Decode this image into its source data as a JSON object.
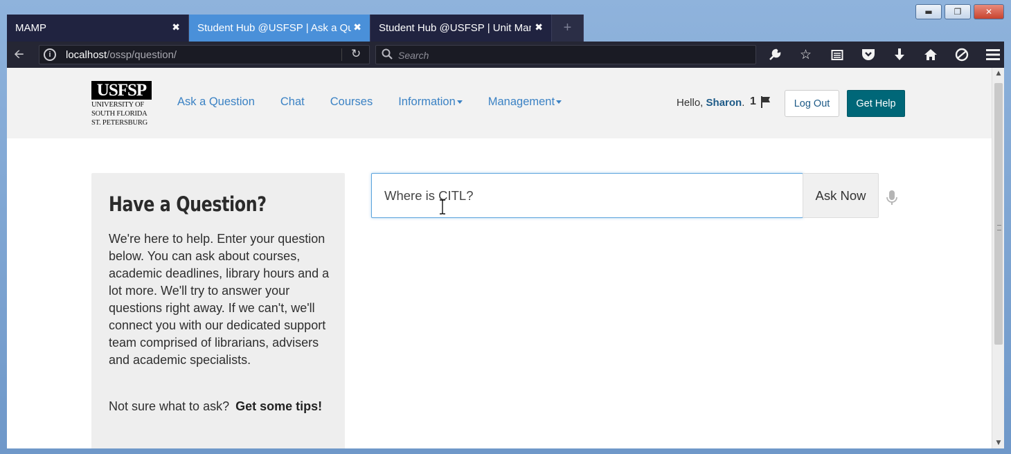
{
  "window": {
    "controls": [
      "minimize",
      "maximize",
      "close"
    ]
  },
  "tabs": [
    {
      "label": "MAMP",
      "active": false
    },
    {
      "label": "Student Hub @USFSP | Ask a Que",
      "active": true
    },
    {
      "label": "Student Hub @USFSP | Unit Mana",
      "active": false
    }
  ],
  "toolbar": {
    "url_host": "localhost",
    "url_path": "/ossp/question/",
    "search_placeholder": "Search",
    "icons": [
      "wrench-icon",
      "star-icon",
      "reading-list-icon",
      "pocket-icon",
      "download-icon",
      "home-icon",
      "sync-icon",
      "menu-icon"
    ]
  },
  "site": {
    "logo_mark": "USFSP",
    "logo_line1": "UNIVERSITY OF",
    "logo_line2": "SOUTH FLORIDA",
    "logo_line3": "ST. PETERSBURG",
    "nav": {
      "ask": "Ask a Question",
      "chat": "Chat",
      "courses": "Courses",
      "information": "Information",
      "management": "Management"
    },
    "greeting_prefix": "Hello, ",
    "user_name": "Sharon",
    "greeting_suffix": ".",
    "flag_count": "1",
    "logout_label": "Log Out",
    "help_label": "Get Help",
    "accent_color": "#006778",
    "link_color": "#3b82c4"
  },
  "main": {
    "card_title": "Have a Question?",
    "card_body": "We're here to help. Enter your question below. You can ask about courses, academic deadlines, library hours and a lot more. We'll try to answer your questions right away. If we can't, we'll connect you with our dedicated support team comprised of librarians, advisers and academic specialists.",
    "card_footer_text": "Not sure what to ask?",
    "card_footer_link": "Get some tips!",
    "question_value": "Where is CITL?",
    "ask_button": "Ask Now"
  }
}
